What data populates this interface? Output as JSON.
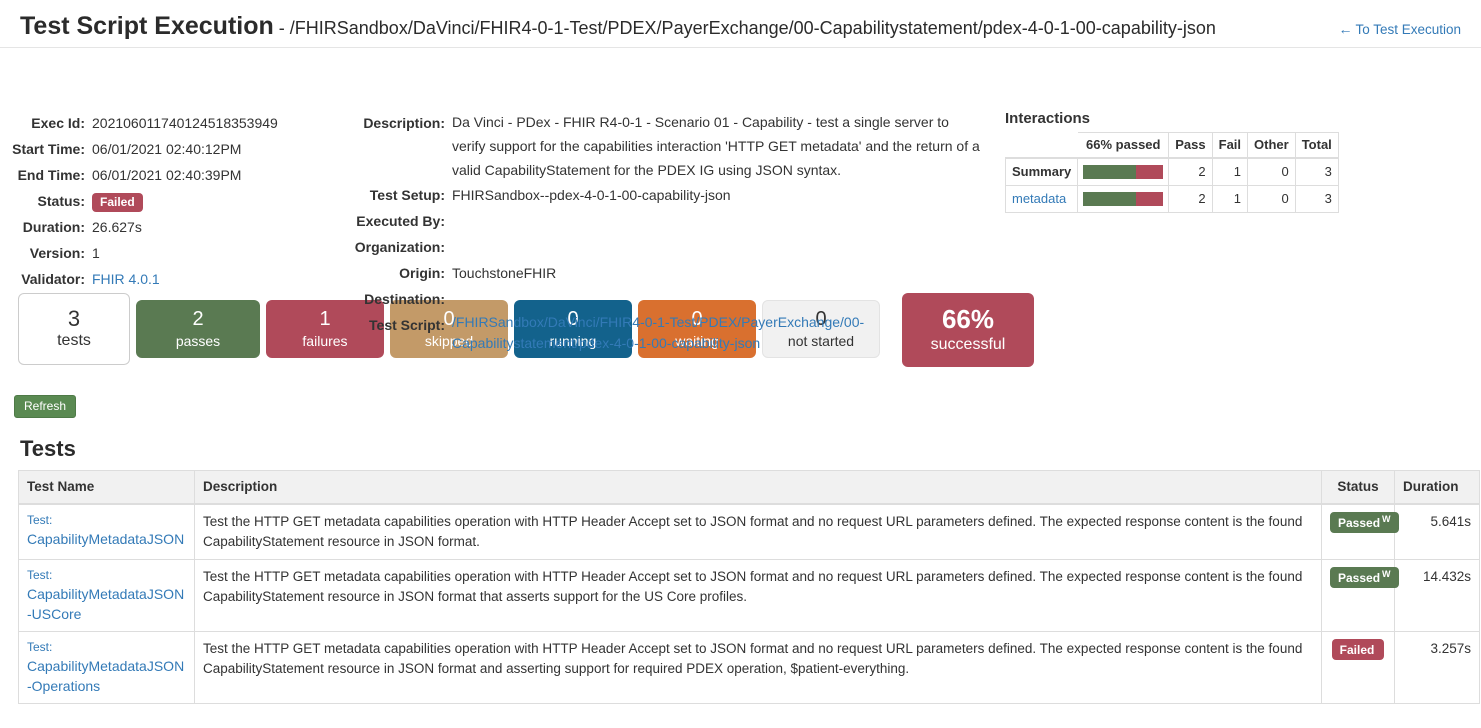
{
  "header": {
    "title": "Test Script Execution",
    "separator": " - ",
    "path": "/FHIRSandbox/DaVinci/FHIR4-0-1-Test/PDEX/PayerExchange/00-Capabilitystatement/pdex-4-0-1-00-capability-json",
    "back_link": "To Test Execution",
    "back_arrow": "←"
  },
  "exec_details": {
    "exec_id_label": "Exec Id:",
    "exec_id": "202106011740124518353949",
    "start_time_label": "Start Time:",
    "start_time": "06/01/2021 02:40:12PM",
    "end_time_label": "End Time:",
    "end_time": "06/01/2021 02:40:39PM",
    "status_label": "Status:",
    "status": "Failed",
    "duration_label": "Duration:",
    "duration": "26.627s",
    "version_label": "Version:",
    "version": "1",
    "validator_label": "Validator:",
    "validator": "FHIR 4.0.1"
  },
  "script_details": {
    "description_label": "Description:",
    "description": "Da Vinci - PDex - FHIR R4-0-1 - Scenario 01 - Capability - test a single server to verify support for the capabilities interaction 'HTTP GET metadata' and the return of a valid CapabilityStatement for the PDEX IG using JSON syntax.",
    "test_setup_label": "Test Setup:",
    "test_setup": "FHIRSandbox--pdex-4-0-1-00-capability-json",
    "executed_by_label": "Executed By:",
    "executed_by": "",
    "organization_label": "Organization:",
    "organization": "",
    "origin_label": "Origin:",
    "origin": "TouchstoneFHIR",
    "destination_label": "Destination:",
    "destination": "",
    "test_script_label": "Test Script:",
    "test_script": "/FHIRSandbox/DaVinci/FHIR4-0-1-Test/PDEX/PayerExchange/00-Capabilitystatement/pdex-4-0-1-00-capability-json"
  },
  "interactions": {
    "title": "Interactions",
    "columns": [
      "",
      "66% passed",
      "Pass",
      "Fail",
      "Other",
      "Total"
    ],
    "rows": [
      {
        "name": "Summary",
        "is_link": false,
        "pass_pct": 66,
        "pass": "2",
        "fail": "1",
        "other": "0",
        "total": "3"
      },
      {
        "name": "metadata",
        "is_link": true,
        "pass_pct": 66,
        "pass": "2",
        "fail": "1",
        "other": "0",
        "total": "3"
      }
    ]
  },
  "stats": [
    {
      "key": "tests",
      "value": "3",
      "label": "tests"
    },
    {
      "key": "passes",
      "value": "2",
      "label": "passes"
    },
    {
      "key": "failures",
      "value": "1",
      "label": "failures"
    },
    {
      "key": "skipped",
      "value": "0",
      "label": "skipped"
    },
    {
      "key": "running",
      "value": "0",
      "label": "running"
    },
    {
      "key": "waiting",
      "value": "0",
      "label": "waiting"
    },
    {
      "key": "notstarted",
      "value": "0",
      "label": "not started"
    },
    {
      "key": "successful",
      "value": "66%",
      "label": "successful"
    }
  ],
  "refresh_label": "Refresh",
  "tests_section": {
    "heading": "Tests",
    "columns": [
      "Test Name",
      "Description",
      "Status",
      "Duration"
    ],
    "rows": [
      {
        "prefix": "Test:",
        "name": "CapabilityMetadataJSON",
        "description": "Test the HTTP GET metadata capabilities operation with HTTP Header Accept set to JSON format and no request URL parameters defined. The expected response content is the found CapabilityStatement resource in JSON format.",
        "status": "Passed",
        "status_sup": "W",
        "duration": "5.641s"
      },
      {
        "prefix": "Test:",
        "name": "CapabilityMetadataJSON-USCore",
        "description": "Test the HTTP GET metadata capabilities operation with HTTP Header Accept set to JSON format and no request URL parameters defined. The expected response content is the found CapabilityStatement resource in JSON format that asserts support for the US Core profiles.",
        "status": "Passed",
        "status_sup": "W",
        "duration": "14.432s"
      },
      {
        "prefix": "Test:",
        "name": "CapabilityMetadataJSON-Operations",
        "description": "Test the HTTP GET metadata capabilities operation with HTTP Header Accept set to JSON format and no request URL parameters defined. The expected response content is the found CapabilityStatement resource in JSON format and asserting support for required PDEX operation, $patient-everything.",
        "status": "Failed",
        "status_sup": "",
        "duration": "3.257s"
      }
    ]
  },
  "colors": {
    "pass_green": "#5a7a52",
    "fail_red": "#b04a5a",
    "skipped_tan": "#c39a68",
    "running_blue": "#13628c",
    "waiting_orange": "#d9702f",
    "notstarted_grey": "#f1f1f1",
    "link_blue": "#337ab7"
  }
}
